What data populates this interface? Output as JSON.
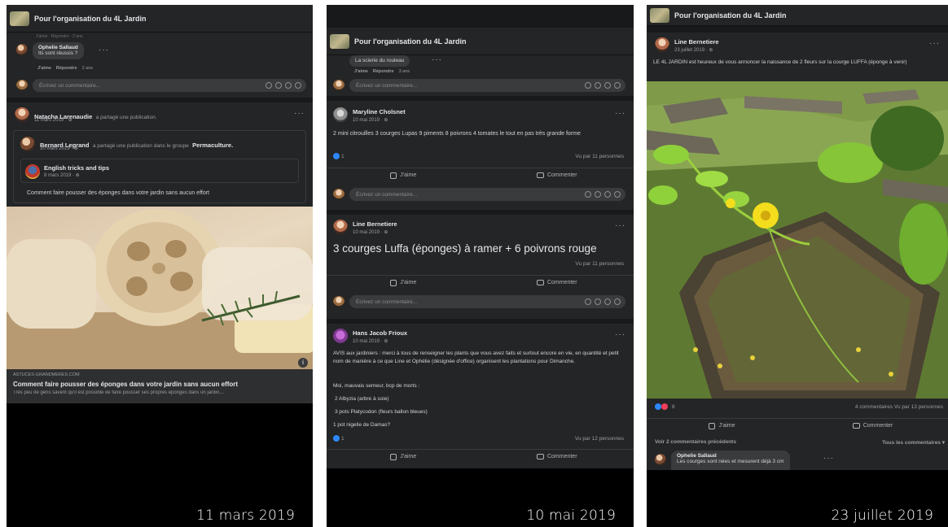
{
  "group_name": "Pour l'organisation du 4L Jardin",
  "panel1": {
    "top_comment": {
      "prev_line": "J'aime · Répondre · 2 ans",
      "author": "Ophelie Sallaud",
      "text": "Ils sont réussis ?",
      "like": "J'aime",
      "reply": "Répondre",
      "age": "2 ans"
    },
    "comment_placeholder": "Écrivez un commentaire...",
    "share": {
      "author": "Natacha Larenaudie",
      "action": "a partagé une publication.",
      "date": "11 mars 2019 · ⊕",
      "inner_author": "Bernard Legrand",
      "inner_action": "a partagé une publication dans le groupe",
      "inner_group": "Permaculture.",
      "inner_date": "10 mars 2019 · ⊕",
      "page_name": "English tricks and tips",
      "page_date": "8 mars 2019 · ⊕",
      "post_text": "Comment faire pousser des éponges dans votre jardin sans aucun effort",
      "link_domain": "ASTUCES-GRANDMERES.COM",
      "link_title": "Comment faire pousser des éponges dans votre jardin sans aucun effort",
      "link_desc": "Très peu de gens savent qu'il est possible de faire pousser ses propres éponges dans un jardin...."
    },
    "date_caption": "11 mars  2019"
  },
  "panel2": {
    "top_comment": {
      "text": "La scierie du rouleau",
      "like": "J'aime",
      "reply": "Répondre",
      "age": "3 ans"
    },
    "comment_placeholder": "Écrivez un commentaire...",
    "posts": [
      {
        "author": "Maryline Cholsnet",
        "date": "10 mai 2019 · ⊕",
        "text": "2 mini citrouilles 3 courges Lupas 9 piments 8 poivrons 4 tomates le tout en pas très grande forme",
        "reactions": "1",
        "views": "Vu par 11 personnes"
      },
      {
        "author": "Line Bernetiere",
        "date": "10 mai 2019 · ⊕",
        "big_text": "3 courges Luffa (éponges) à ramer + 6 poivrons rouge",
        "views": "Vu par 11 personnes"
      },
      {
        "author": "Hans Jacob Frioux",
        "date": "10 mai 2019 · ⊕",
        "text": "AVIS aux jardiniers : merci à tous de renseigner les plants que vous avez faits et surtout encore en vie, en quantité et petit nom de manière à ce que Line et Ophélie (désignée d'office) organisent les plantations pour Dimanche.",
        "line2": "Moi, mauvais semeur, bcp de morts :",
        "list": [
          "2 Albyzia (arbre à soie)",
          "3 pots Platycodon (fleurs ballon bleues)",
          "1  pot nigelle de Damas?"
        ],
        "reactions": "1",
        "views": "Vu par 12 personnes"
      }
    ],
    "like_label": "J'aime",
    "comment_label": "Commenter",
    "date_caption": "10 mai 2019"
  },
  "panel3": {
    "author": "Line Bernetiere",
    "date": "23 juillet 2019 · ⊕",
    "text": "LE 4L JARDIN est heureux de vous annoncer la naissance de 2 fleurs sur la courge LUFFA (éponge à venir)",
    "reactions": "8",
    "stats": "4 commentaires  Vu par 13 personnes",
    "like_label": "J'aime",
    "comment_label": "Commenter",
    "prev_comments": "Voir 2 commentaires précédents",
    "all_comments": "Tous les commentaires ▾",
    "comment_author": "Ophelie Sallaud",
    "comment_text": "Les courges sont nées et mesurent déjà 3 cm",
    "date_caption": "23 juillet 2019"
  }
}
